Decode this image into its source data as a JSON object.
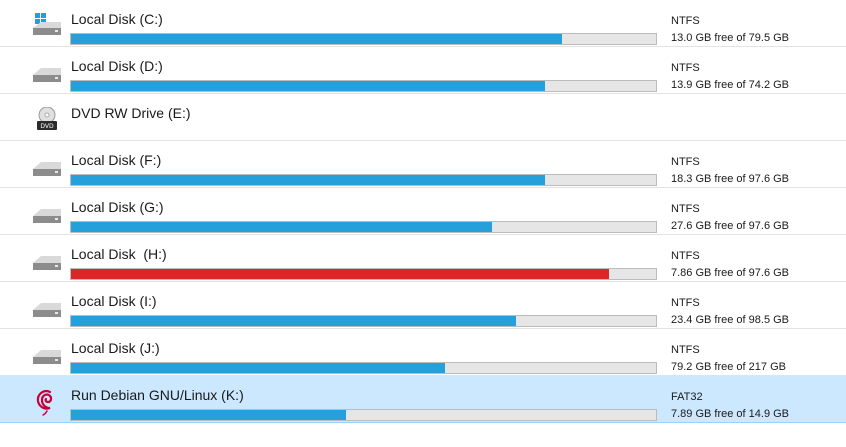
{
  "colors": {
    "bar_normal": "#26a0da",
    "bar_full": "#da2626",
    "bar_track": "#e6e6e6",
    "selected_row": "#cce8ff"
  },
  "drives": [
    {
      "name": "Local Disk (C:)",
      "icon": "windows-drive-icon",
      "fs": "NTFS",
      "free": "13.0 GB free of 79.5 GB",
      "used_fraction": 0.84,
      "status": "normal",
      "selected": false
    },
    {
      "name": "Local Disk (D:)",
      "icon": "hard-drive-icon",
      "fs": "NTFS",
      "free": "13.9 GB free of 74.2 GB",
      "used_fraction": 0.81,
      "status": "normal",
      "selected": false
    },
    {
      "name": "DVD RW Drive (E:)",
      "icon": "dvd-drive-icon",
      "fs": "",
      "free": "",
      "used_fraction": null,
      "status": "none",
      "selected": false
    },
    {
      "name": "Local Disk (F:)",
      "icon": "hard-drive-icon",
      "fs": "NTFS",
      "free": "18.3 GB free of 97.6 GB",
      "used_fraction": 0.81,
      "status": "normal",
      "selected": false
    },
    {
      "name": "Local Disk (G:)",
      "icon": "hard-drive-icon",
      "fs": "NTFS",
      "free": "27.6 GB free of 97.6 GB",
      "used_fraction": 0.72,
      "status": "normal",
      "selected": false
    },
    {
      "name": "Local Disk  (H:)",
      "icon": "hard-drive-icon",
      "fs": "NTFS",
      "free": "7.86 GB free of 97.6 GB",
      "used_fraction": 0.92,
      "status": "full",
      "selected": false
    },
    {
      "name": "Local Disk (I:)",
      "icon": "hard-drive-icon",
      "fs": "NTFS",
      "free": "23.4 GB free of 98.5 GB",
      "used_fraction": 0.76,
      "status": "normal",
      "selected": false
    },
    {
      "name": "Local Disk (J:)",
      "icon": "hard-drive-icon",
      "fs": "NTFS",
      "free": "79.2 GB free of 217 GB",
      "used_fraction": 0.64,
      "status": "normal",
      "selected": false
    },
    {
      "name": "Run Debian GNU/Linux (K:)",
      "icon": "debian-swirl-icon",
      "fs": "FAT32",
      "free": "7.89 GB free of 14.9 GB",
      "used_fraction": 0.47,
      "status": "normal",
      "selected": true
    }
  ]
}
